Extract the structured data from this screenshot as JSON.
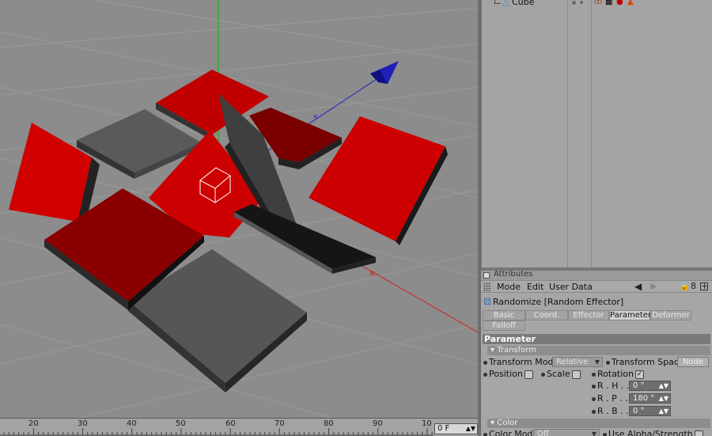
{
  "object_manager": {
    "object_name": "Cube",
    "cube_icon": "cube-icon",
    "tags": [
      "phong-tag-icon",
      "texture-tag-icon",
      "material-icon",
      "effector-tag-icon"
    ]
  },
  "attributes": {
    "title": "Attributes",
    "menu": [
      "Mode",
      "Edit",
      "User Data"
    ],
    "toolbar_icons": [
      "arrow-left-icon",
      "arrow-right-icon",
      "lock-icon",
      "link-icon",
      "new-window-icon"
    ],
    "object_title": "Randomize [Random Effector]",
    "tabs": [
      "Basic",
      "Coord.",
      "Effector",
      "Parameter",
      "Deformer",
      "Falloff"
    ],
    "active_tab": "Parameter",
    "section": "Parameter",
    "transform_group": "Transform",
    "transform_mode_label": "Transform Mode",
    "transform_mode_value": "Relative",
    "transform_space_label": "Transform Space",
    "transform_space_value": "Node",
    "position_label": "Position",
    "scale_label": "Scale",
    "rotation_label": "Rotation",
    "rot_h_label": "R . H . . .",
    "rot_h_value": "0 °",
    "rot_p_label": "R . P . . .",
    "rot_p_value": "180 °",
    "rot_b_label": "R . B . . .",
    "rot_b_value": "0 °",
    "color_group": "Color",
    "color_mode_label": "Color Mode",
    "color_mode_value": "Off",
    "use_alpha_label": "Use Alpha/Strength"
  },
  "timeline": {
    "ticks": [
      "20",
      "30",
      "40",
      "50",
      "60",
      "70",
      "80",
      "90",
      "10"
    ],
    "frame": "0 F"
  },
  "colors": {
    "accent_red": "#d90000",
    "dark_red": "#7a0000",
    "gray_plate": "#555555",
    "axis_green": "#00c000",
    "axis_blue": "#2020c0",
    "axis_red": "#d02020"
  }
}
